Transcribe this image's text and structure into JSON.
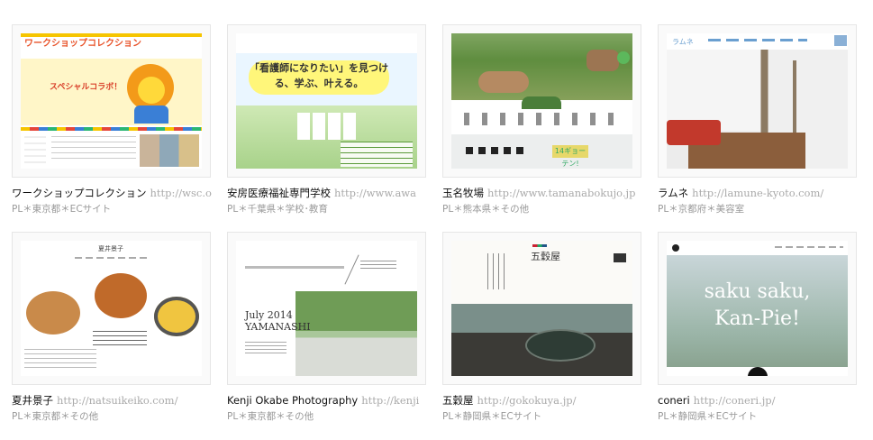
{
  "sites": [
    {
      "name": "ワークショップコレクション",
      "url": "http://wsc.or.jp/",
      "meta": "PL＊東京都＊ECサイト",
      "thumb": {
        "logo": "ワークショップコレクション",
        "hero_text": "スペシャルコラボ！"
      }
    },
    {
      "name": "安房医療福祉専門学校",
      "url": "http://www.awa",
      "meta": "PL＊千葉県＊学校･教育",
      "thumb": {
        "headline": "「看護師になりたい」を見つける、学ぶ、叶える。"
      }
    },
    {
      "name": "玉名牧場",
      "url": "http://www.tamanabokujo.jp",
      "meta": "PL＊熊本県＊その他",
      "thumb": {
        "tag": "14ギョーテン!"
      }
    },
    {
      "name": "ラムネ",
      "url": "http://lamune-kyoto.com/",
      "meta": "PL＊京都府＊美容室",
      "thumb": {
        "logo": "ラムネ"
      }
    },
    {
      "name": "夏井景子",
      "url": "http://natsuikeiko.com/",
      "meta": "PL＊東京都＊その他",
      "thumb": {
        "logo": "夏井景子"
      }
    },
    {
      "name": "Kenji Okabe Photography",
      "url": "http://kenji",
      "meta": "PL＊東京都＊その他",
      "thumb": {
        "date_line1": "July 2014",
        "date_line2": "YAMANASHI"
      }
    },
    {
      "name": "五穀屋",
      "url": "http://gokokuya.jp/",
      "meta": "PL＊静岡県＊ECサイト",
      "thumb": {
        "logo": "五穀屋"
      }
    },
    {
      "name": "coneri",
      "url": "http://coneri.jp/",
      "meta": "PL＊静岡県＊ECサイト",
      "thumb": {
        "line1": "saku saku,",
        "line2": "Kan-Pie!"
      }
    }
  ]
}
